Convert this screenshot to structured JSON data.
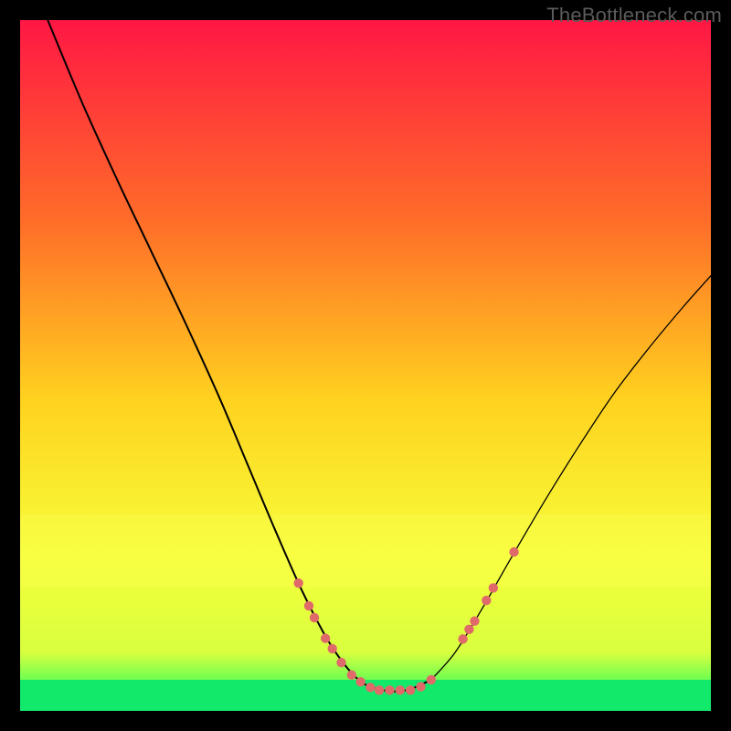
{
  "watermark": "TheBottleneck.com",
  "chart_data": {
    "type": "line",
    "title": "",
    "xlabel": "",
    "ylabel": "",
    "xlim": [
      0,
      100
    ],
    "ylim": [
      0,
      100
    ],
    "grid": false,
    "legend": false,
    "gradient_stops": [
      {
        "offset": 0,
        "color": "#ff1744"
      },
      {
        "offset": 0.3,
        "color": "#ff7028"
      },
      {
        "offset": 0.55,
        "color": "#ffd21f"
      },
      {
        "offset": 0.78,
        "color": "#f6ff3a"
      },
      {
        "offset": 0.915,
        "color": "#d8ff3f"
      },
      {
        "offset": 0.95,
        "color": "#7cff4f"
      },
      {
        "offset": 1.0,
        "color": "#12e86a"
      }
    ],
    "bands": [
      {
        "name": "wide-yellow-band",
        "y_top": 71.5,
        "y_bottom": 82.0,
        "color": "#fdff55",
        "opacity": 0.3
      },
      {
        "name": "green-floor-band",
        "y_top": 95.5,
        "y_bottom": 100,
        "color": "#12e86a",
        "opacity": 1.0
      }
    ],
    "series": [
      {
        "name": "left-curve",
        "color": "#000000",
        "width": 2.0,
        "points": [
          {
            "x": 4.0,
            "y": 0.0
          },
          {
            "x": 9.0,
            "y": 12.0
          },
          {
            "x": 14.0,
            "y": 23.0
          },
          {
            "x": 19.0,
            "y": 33.5
          },
          {
            "x": 24.0,
            "y": 44.0
          },
          {
            "x": 29.0,
            "y": 55.0
          },
          {
            "x": 33.0,
            "y": 64.5
          },
          {
            "x": 37.0,
            "y": 74.0
          },
          {
            "x": 41.0,
            "y": 83.0
          },
          {
            "x": 45.0,
            "y": 90.5
          },
          {
            "x": 49.0,
            "y": 95.5
          },
          {
            "x": 52.5,
            "y": 97.0
          },
          {
            "x": 56.0,
            "y": 97.0
          },
          {
            "x": 59.5,
            "y": 95.5
          }
        ]
      },
      {
        "name": "right-curve",
        "color": "#000000",
        "width": 1.3,
        "points": [
          {
            "x": 59.5,
            "y": 95.5
          },
          {
            "x": 63.0,
            "y": 91.5
          },
          {
            "x": 67.0,
            "y": 85.0
          },
          {
            "x": 71.0,
            "y": 78.0
          },
          {
            "x": 76.0,
            "y": 69.5
          },
          {
            "x": 81.0,
            "y": 61.5
          },
          {
            "x": 86.0,
            "y": 54.0
          },
          {
            "x": 91.0,
            "y": 47.5
          },
          {
            "x": 96.0,
            "y": 41.5
          },
          {
            "x": 100.0,
            "y": 37.0
          }
        ]
      }
    ],
    "markers": {
      "name": "highlight-dots",
      "color": "#e06a6a",
      "radius": 5.2,
      "points": [
        {
          "x": 40.3,
          "y": 81.5
        },
        {
          "x": 41.8,
          "y": 84.8
        },
        {
          "x": 42.6,
          "y": 86.5
        },
        {
          "x": 44.2,
          "y": 89.5
        },
        {
          "x": 45.2,
          "y": 91.0
        },
        {
          "x": 46.5,
          "y": 93.0
        },
        {
          "x": 48.0,
          "y": 94.8
        },
        {
          "x": 49.3,
          "y": 95.8
        },
        {
          "x": 50.7,
          "y": 96.6
        },
        {
          "x": 52.0,
          "y": 97.0
        },
        {
          "x": 53.5,
          "y": 97.0
        },
        {
          "x": 55.0,
          "y": 97.0
        },
        {
          "x": 56.5,
          "y": 97.0
        },
        {
          "x": 58.0,
          "y": 96.5
        },
        {
          "x": 59.5,
          "y": 95.5
        },
        {
          "x": 64.1,
          "y": 89.6
        },
        {
          "x": 65.0,
          "y": 88.2
        },
        {
          "x": 65.8,
          "y": 87.0
        },
        {
          "x": 67.5,
          "y": 84.0
        },
        {
          "x": 68.5,
          "y": 82.2
        },
        {
          "x": 71.5,
          "y": 77.0
        }
      ]
    }
  }
}
